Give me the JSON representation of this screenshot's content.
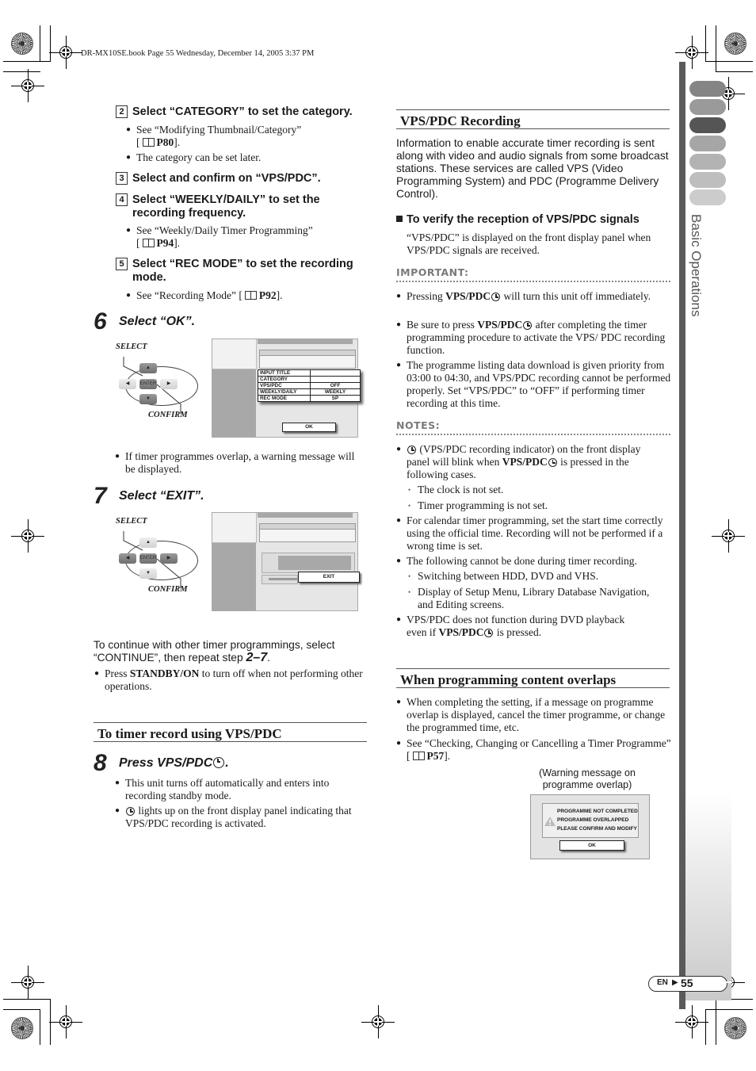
{
  "header": {
    "book_line": "DR-MX10SE.book  Page 55  Wednesday, December 14, 2005  3:37 PM"
  },
  "side_tab": {
    "label": "Basic Operations",
    "tab_colors": [
      "#858585",
      "#9a9a9a",
      "#555555",
      "#a6a6a6",
      "#b3b3b3",
      "#bebebe",
      "#cccccc"
    ]
  },
  "left": {
    "steps_small": [
      {
        "num": "2",
        "text": "Select “CATEGORY” to set the category."
      },
      {
        "num": "3",
        "text": "Select and confirm on “VPS/PDC”."
      },
      {
        "num": "4",
        "text": "Select “WEEKLY/DAILY” to set the recording frequency."
      },
      {
        "num": "5",
        "text": "Select “REC MODE” to set the recording mode."
      }
    ],
    "step2_bullets": [
      {
        "text": "See “Modifying Thumbnail/Category”",
        "ref": "P80"
      },
      {
        "text": "The category can be set later."
      }
    ],
    "step4_bullet": {
      "text": "See “Weekly/Daily Timer Programming”",
      "ref": "P94"
    },
    "step5_bullet": {
      "text": "See “Recording Mode”",
      "ref": "P92"
    },
    "step6": {
      "num": "6",
      "title": "Select “OK”."
    },
    "step7": {
      "num": "7",
      "title": "Select “EXIT”."
    },
    "remote": {
      "select_label": "SELECT",
      "confirm_label": "CONFIRM",
      "enter_key": "ENTER"
    },
    "screen1": {
      "rows": [
        {
          "label": "INPUT TITLE",
          "value": ""
        },
        {
          "label": "CATEGORY",
          "value": ""
        },
        {
          "label": "VPS/PDC",
          "value": "OFF"
        },
        {
          "label": "WEEKLY/DAILY",
          "value": "WEEKLY"
        },
        {
          "label": "REC MODE",
          "value": "SP"
        }
      ],
      "ok_button": "OK"
    },
    "screen2": {
      "exit_button": "EXIT"
    },
    "overlap_bullet": "If timer programmes overlap, a warning message will be displayed.",
    "continue_text_1": "To continue with other timer programmings, select",
    "continue_text_2": "“CONTINUE”, then repeat step",
    "continue_steps": "2–7",
    "standby_bullet": {
      "pre": "Press",
      "bold": "STANDBY/ON",
      "post": "to turn off when not performing other operations."
    },
    "section_vps_timer": "To timer record using VPS/PDC",
    "step8": {
      "num": "8",
      "title": "Press VPS/PDC"
    },
    "step8_bullets": [
      "This unit turns off automatically and enters into recording standby mode.",
      "lights up on the front display panel indicating that VPS/PDC recording is activated."
    ]
  },
  "right": {
    "section_vps": "VPS/PDC Recording",
    "intro": "Information to enable accurate timer recording is sent along with video and audio signals from some broadcast stations. These services are called VPS (Video Programming System) and PDC (Programme Delivery Control).",
    "verify_heading": "To verify the reception of VPS/PDC signals",
    "verify_text": "“VPS/PDC” is displayed on the front display panel when VPS/PDC signals are received.",
    "important_label": "IMPORTANT:",
    "important_bullets": [
      {
        "pre": "Pressing",
        "bold": "VPS/PDC",
        "post": "will turn this unit off immediately."
      },
      {
        "pre": "Be sure to press",
        "bold": "VPS/PDC",
        "post": "after completing the timer programming procedure to activate the VPS/ PDC recording function."
      },
      {
        "text": "The programme listing data download is given priority from 03:00 to 04:30, and VPS/PDC recording cannot be performed properly. Set “VPS/PDC” to “OFF” if performing timer recording at this time."
      }
    ],
    "notes_label": "NOTES:",
    "notes": {
      "n1_a": "(VPS/PDC recording indicator) on the front display",
      "n1_b_pre": "panel will blink when",
      "n1_b_bold": "VPS/PDC",
      "n1_b_post": "is pressed in the",
      "n1_c": "following cases.",
      "n1_sub": [
        "The clock is not set.",
        "Timer programming is not set."
      ],
      "n2": "For calendar timer programming, set the start time correctly using the official time. Recording will not be performed if a wrong time is set.",
      "n3": "The following cannot be done during timer recording.",
      "n3_sub": [
        "Switching between HDD, DVD and VHS.",
        "Display of Setup Menu, Library Database Navigation, and Editing screens."
      ],
      "n4_a": "VPS/PDC does not function during DVD playback",
      "n4_b_pre": "even if",
      "n4_b_bold": "VPS/PDC",
      "n4_b_post": "is pressed."
    },
    "section_overlap": "When programming content overlaps",
    "overlap_bullets": [
      "When completing the setting, if a message on programme overlap is displayed, cancel the timer programme, or change the programmed time, etc.",
      {
        "text": "See “Checking, Changing or Cancelling a Timer Programme”",
        "ref": "P57"
      }
    ],
    "warning_caption": "(Warning message on programme overlap)",
    "warning_lines": [
      "PROGRAMME NOT COMPLETED",
      "PROGRAMME OVERLAPPED",
      "PLEASE CONFIRM AND MODIFY"
    ],
    "warning_ok": "OK"
  },
  "footer": {
    "lang": "EN",
    "page": "55"
  }
}
